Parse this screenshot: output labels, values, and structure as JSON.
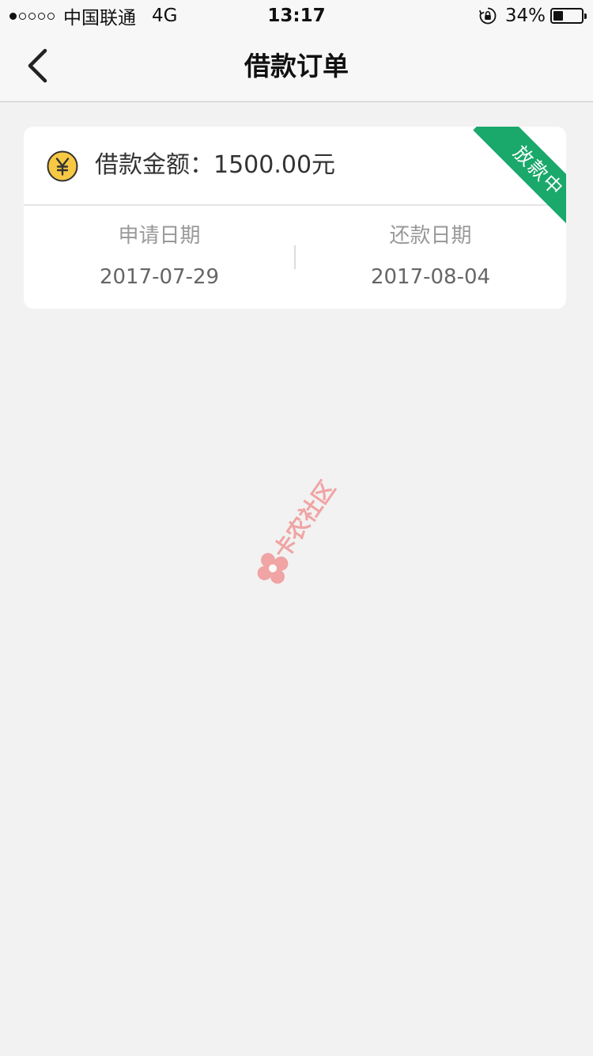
{
  "status_bar": {
    "signal_dots": 5,
    "signal_filled": 1,
    "carrier": "中国联通",
    "network": "4G",
    "time": "13:17",
    "battery_pct": "34%",
    "battery_level": 0.34
  },
  "nav": {
    "title": "借款订单"
  },
  "order": {
    "amount_label": "借款金额：",
    "amount_value": "1500.00元",
    "status": "放款中",
    "apply_date_label": "申请日期",
    "apply_date": "2017-07-29",
    "repay_date_label": "还款日期",
    "repay_date": "2017-08-04"
  },
  "watermark": {
    "text": "卡农社区"
  },
  "colors": {
    "background": "#f2f2f2",
    "card": "#ffffff",
    "ribbon": "#1aa86b",
    "coin": "#f7c843",
    "watermark": "#f08a8a"
  },
  "icons": {
    "back": "chevron-left-icon",
    "coin": "yuan-coin-icon",
    "lock": "rotation-lock-icon",
    "battery": "battery-icon"
  }
}
